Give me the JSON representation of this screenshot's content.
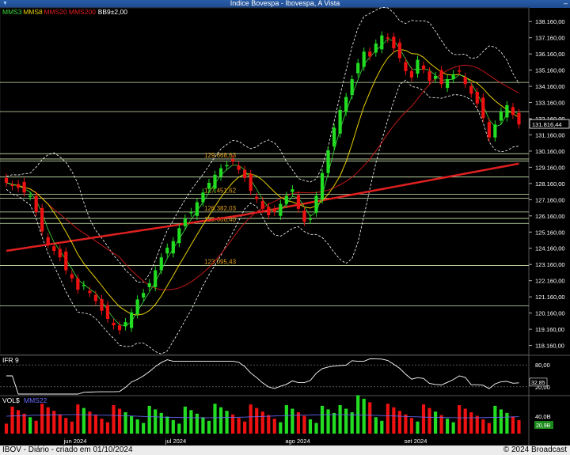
{
  "window": {
    "title": "Indice Bovespa - Ibovespa, A Vista",
    "icon": "bar-chart-icon",
    "minimize_label": "–"
  },
  "legend": [
    {
      "label": "MMS3",
      "color": "#3ddc3d"
    },
    {
      "label": "MMS8",
      "color": "#e8d000"
    },
    {
      "label": "MMS20",
      "color": "#e02020"
    },
    {
      "label": "MMS200",
      "color": "#e02020"
    },
    {
      "label": "BB9±2,00",
      "color": "#ffffff"
    }
  ],
  "price_axis": [
    "138.160,00",
    "137.160,00",
    "136.160,00",
    "135.160,00",
    "134.160,00",
    "133.160,00",
    "132.160,00",
    "131.160,00",
    "130.160,00",
    "129.160,00",
    "128.160,00",
    "127.160,00",
    "126.160,00",
    "125.160,00",
    "124.160,00",
    "123.160,00",
    "122.160,00",
    "121.160,00",
    "120.160,00",
    "119.160,00",
    "118.160,00"
  ],
  "last_price": "131.816,44",
  "levels": [
    {
      "value": 134.4
    },
    {
      "value": 132.6
    },
    {
      "value": 130.0
    },
    {
      "value": 129.55
    },
    {
      "value": 129.67,
      "label": "129.668,63"
    },
    {
      "value": 128.56
    },
    {
      "value": 127.5,
      "label": "127.451,62"
    },
    {
      "value": 127.25
    },
    {
      "value": 126.4,
      "label": "126.382,03"
    },
    {
      "value": 126.0
    },
    {
      "value": 125.7,
      "label": "125.666,40"
    },
    {
      "value": 123.1,
      "label": "123.095,43"
    },
    {
      "value": 120.6
    }
  ],
  "ifr": {
    "label": "IFR 9",
    "axis": [
      "80,00",
      "20,00"
    ],
    "current": "32,85"
  },
  "volume": {
    "label": "VOL$",
    "ma_label": "MMS22",
    "axis": [
      "40,0B"
    ],
    "current": "20,9B"
  },
  "months": [
    "jun 2024",
    "jul 2024",
    "ago 2024",
    "set 2024"
  ],
  "footer": {
    "left": "IBOV - Diário - criado em 01/10/2024",
    "right": "© 2024 Broadcast"
  },
  "chart_data": {
    "type": "candlestick",
    "title": "Indice Bovespa - Ibovespa, A Vista",
    "ylim": [
      117.6,
      139.0
    ],
    "closes": [
      128.2,
      128.0,
      127.9,
      127.6,
      127.4,
      126.4,
      125.2,
      124.4,
      124.0,
      123.6,
      122.8,
      122.3,
      121.6,
      121.9,
      121.4,
      120.9,
      120.3,
      119.8,
      119.4,
      119.1,
      119.6,
      120.2,
      121.0,
      121.4,
      122.0,
      122.8,
      123.6,
      124.2,
      124.6,
      125.4,
      126.0,
      126.4,
      127.0,
      127.6,
      128.2,
      128.7,
      129.1,
      129.3,
      129.5,
      129.0,
      128.5,
      127.7,
      127.2,
      126.6,
      126.2,
      126.4,
      126.9,
      127.4,
      127.8,
      126.6,
      125.8,
      126.0,
      127.4,
      128.8,
      130.2,
      131.6,
      132.7,
      133.5,
      134.6,
      135.6,
      136.3,
      136.0,
      136.8,
      137.3,
      137.1,
      136.5,
      135.9,
      135.1,
      134.7,
      135.8,
      135.2,
      134.5,
      134.8,
      134.3,
      134.6,
      134.9,
      135.1,
      134.3,
      133.7,
      133.1,
      132.2,
      131.0,
      131.8,
      132.6,
      133.0,
      132.4,
      131.8
    ]
  }
}
